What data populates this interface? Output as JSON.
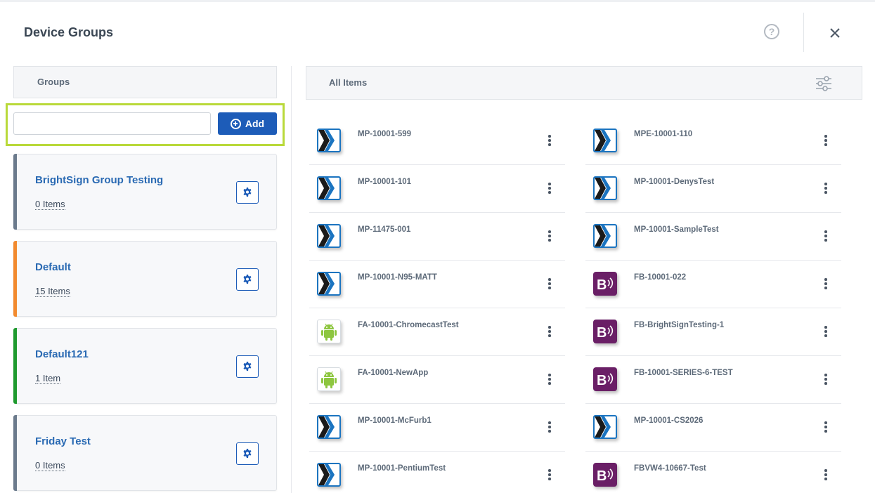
{
  "dialog": {
    "title": "Device Groups",
    "help_icon": "help-circle-icon",
    "close_icon": "close-icon"
  },
  "groups_panel": {
    "header": "Groups",
    "input": {
      "value": "",
      "placeholder": ""
    },
    "add_label": "Add",
    "groups": [
      {
        "name": "BrightSign Group Testing",
        "count": "0 Items",
        "color": "#6b7a8c"
      },
      {
        "name": "Default",
        "count": "15 Items",
        "color": "#f28a2e"
      },
      {
        "name": "Default121",
        "count": "1 Item",
        "color": "#1e9a2e"
      },
      {
        "name": "Friday Test",
        "count": "0 Items",
        "color": "#6b7a8c"
      }
    ]
  },
  "items_panel": {
    "header": "All Items",
    "filter_icon": "sliders-icon",
    "items": [
      {
        "label": "MP-10001-599",
        "icon": "media-player-icon"
      },
      {
        "label": "MPE-10001-110",
        "icon": "media-player-icon"
      },
      {
        "label": "MP-10001-101",
        "icon": "media-player-icon"
      },
      {
        "label": "MP-10001-DenysTest",
        "icon": "media-player-icon"
      },
      {
        "label": "MP-11475-001",
        "icon": "media-player-icon"
      },
      {
        "label": "MP-10001-SampleTest",
        "icon": "media-player-icon"
      },
      {
        "label": "MP-10001-N95-MATT",
        "icon": "media-player-icon"
      },
      {
        "label": "FB-10001-022",
        "icon": "brightsign-icon"
      },
      {
        "label": "FA-10001-ChromecastTest",
        "icon": "android-icon"
      },
      {
        "label": "FB-BrightSignTesting-1",
        "icon": "brightsign-icon"
      },
      {
        "label": "FA-10001-NewApp",
        "icon": "android-icon"
      },
      {
        "label": "FB-10001-SERIES-6-TEST",
        "icon": "brightsign-icon"
      },
      {
        "label": "MP-10001-McFurb1",
        "icon": "media-player-icon"
      },
      {
        "label": "MP-10001-CS2026",
        "icon": "media-player-icon"
      },
      {
        "label": "MP-10001-PentiumTest",
        "icon": "media-player-icon"
      },
      {
        "label": "FBVW4-10667-Test",
        "icon": "brightsign-icon"
      }
    ]
  },
  "colors": {
    "accent": "#1d5cb8",
    "highlight": "#b9d93a",
    "link": "#2a6ab3"
  }
}
